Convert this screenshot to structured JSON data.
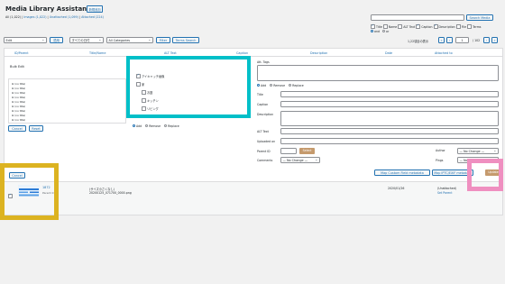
{
  "page": {
    "title": "Media Library Assistant",
    "add_new": "新規追加"
  },
  "filters": {
    "all": "All (1,022)",
    "images": "Images (1,022)",
    "unattached": "Unattached (1,099)",
    "attached": "Attached (224)"
  },
  "search": {
    "button": "Search Media",
    "fields": [
      {
        "label": "Title",
        "checked": true
      },
      {
        "label": "Name",
        "checked": false
      },
      {
        "label": "ALT Text",
        "checked": false
      },
      {
        "label": "Caption",
        "checked": true
      },
      {
        "label": "Description",
        "checked": true
      },
      {
        "label": "File",
        "checked": false
      },
      {
        "label": "Terms",
        "checked": false
      }
    ],
    "connector_and": "and",
    "connector_or": "or"
  },
  "toolbar": {
    "bulk_action": "Edit",
    "apply": "適用",
    "date_filter": "すべての日付",
    "category_filter": "All Categories",
    "filter_button": "Filter",
    "terms_search": "Terms Search",
    "items_count": "1,22項目の表示",
    "pagination_first": "«",
    "pagination_prev": "‹",
    "current_page": "1",
    "total_pages": "/ 102",
    "pagination_next": "›",
    "pagination_last": "»"
  },
  "table": {
    "columns": [
      "ID/Parent",
      "Title/Name",
      "ALT Text",
      "Caption",
      "Description",
      "Date",
      "Attached to"
    ]
  },
  "bulk_edit": {
    "heading": "Bulk Edit",
    "files": [
      "(no title)",
      "(no title)",
      "(no title)",
      "(no title)",
      "(no title)",
      "(no title)",
      "(no title)",
      "(no title)",
      "(no title)"
    ],
    "cancel": "Cancel",
    "reset": "Reset",
    "categories": [
      {
        "label": "アイキャッチ画像",
        "checked": true,
        "level": 0
      },
      {
        "label": "家",
        "checked": false,
        "level": 0
      },
      {
        "label": "お庭",
        "checked": false,
        "level": 1
      },
      {
        "label": "キッチン",
        "checked": false,
        "level": 1
      },
      {
        "label": "リビング",
        "checked": false,
        "level": 1
      }
    ],
    "cat_mode": {
      "add": "Add",
      "remove": "Remove",
      "replace": "Replace"
    },
    "att_tags_label": "Att. Tags",
    "tag_mode": {
      "add": "Add",
      "remove": "Remove",
      "replace": "Replace"
    },
    "fields": [
      "Title",
      "Caption",
      "Description",
      "ALT Text",
      "Uploaded on"
    ],
    "parent_id_label": "Parent ID",
    "select_button": "Select",
    "comments_label": "Comments",
    "comments_value": "— No Change —",
    "author_label": "Author",
    "author_value": "— No Change —",
    "pings_label": "Pings",
    "pings_value": "— No Change —",
    "map_custom": "Map Custom Field metadata",
    "map_iptc": "Map IPTC/EXIF metadata",
    "update": "Update",
    "cancel_bottom": "Cancel"
  },
  "row": {
    "id": "1872",
    "parent_label": "Parent:0",
    "title": "(サイズ小さくなし)",
    "name": "20200125_071700_0000.png",
    "date": "2020/01/26",
    "attached": "(Unattached)",
    "set_parent": "Set Parent"
  },
  "colors": {
    "primary": "#2271b1",
    "cyan_highlight": "#00bfc8",
    "gold_highlight": "#dcb321",
    "pink_highlight": "#ef8fc0",
    "update_button": "#c59a6d"
  }
}
